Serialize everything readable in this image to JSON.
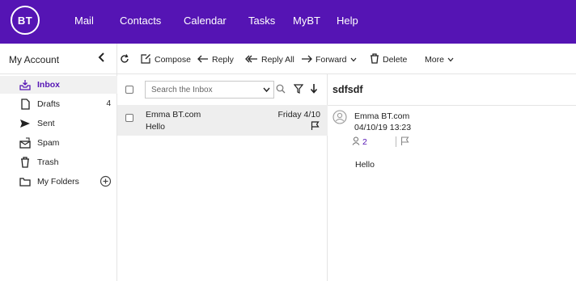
{
  "header": {
    "logo_text": "BT",
    "brand_color": "#5514b4",
    "nav": [
      "Mail",
      "Contacts",
      "Calendar",
      "Tasks",
      "MyBT",
      "Help"
    ]
  },
  "sidebar": {
    "title": "My Account",
    "folders": [
      {
        "label": "Inbox",
        "icon": "inbox-icon",
        "count": ""
      },
      {
        "label": "Drafts",
        "icon": "drafts-icon",
        "count": "4"
      },
      {
        "label": "Sent",
        "icon": "sent-icon",
        "count": ""
      },
      {
        "label": "Spam",
        "icon": "spam-icon",
        "count": ""
      },
      {
        "label": "Trash",
        "icon": "trash-icon",
        "count": ""
      },
      {
        "label": "My Folders",
        "icon": "folder-icon",
        "count": ""
      }
    ]
  },
  "toolbar": {
    "compose": "Compose",
    "reply": "Reply",
    "reply_all": "Reply All",
    "forward": "Forward",
    "delete": "Delete",
    "more": "More"
  },
  "list": {
    "search_placeholder": "Search the Inbox",
    "messages": [
      {
        "from": "Emma BT.com",
        "subject": "Hello",
        "date": "Friday 4/10"
      }
    ]
  },
  "reading": {
    "subject": "sdfsdf",
    "from": "Emma BT.com",
    "date": "04/10/19 13:23",
    "recipients_count": "2",
    "body": "Hello"
  }
}
